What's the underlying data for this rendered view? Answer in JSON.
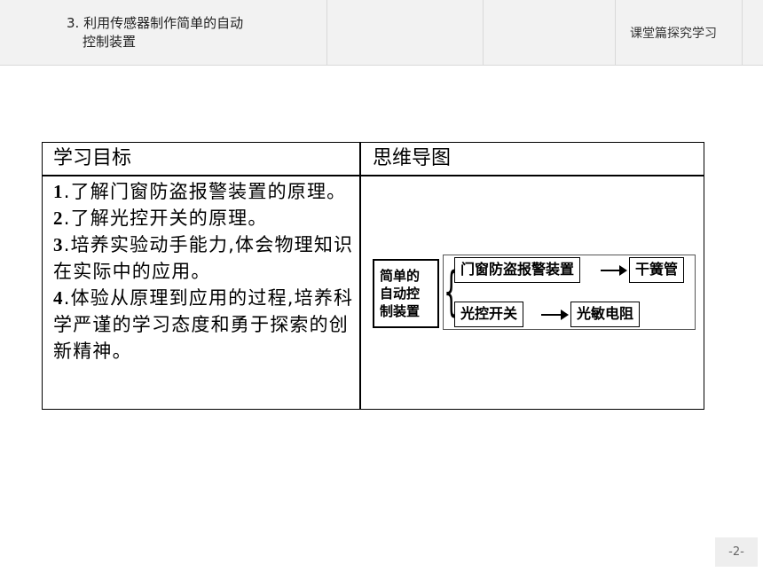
{
  "header": {
    "chapter_line1": "3. 利用传感器制作简单的自动",
    "chapter_line2": "控制装置",
    "section": "课堂篇探究学习"
  },
  "table": {
    "col1_header": "学习目标",
    "col2_header": "思维导图",
    "goals": [
      {
        "num": "1",
        "text": ".了解门窗防盗报警装置的原理。"
      },
      {
        "num": "2",
        "text": ".了解光控开关的原理。"
      },
      {
        "num": "3",
        "text": ".培养实验动手能力,体会物理知识在实际中的应用。"
      },
      {
        "num": "4",
        "text": ".体验从原理到应用的过程,培养科学严谨的学习态度和勇于探索的创新精神。"
      }
    ]
  },
  "mindmap": {
    "root_lines": [
      "简单的",
      "自动控",
      "制装置"
    ],
    "branch1": "门窗防盗报警装置",
    "branch1_target": "干簧管",
    "branch2": "光控开关",
    "branch2_target": "光敏电阻"
  },
  "page_number": "-2-"
}
